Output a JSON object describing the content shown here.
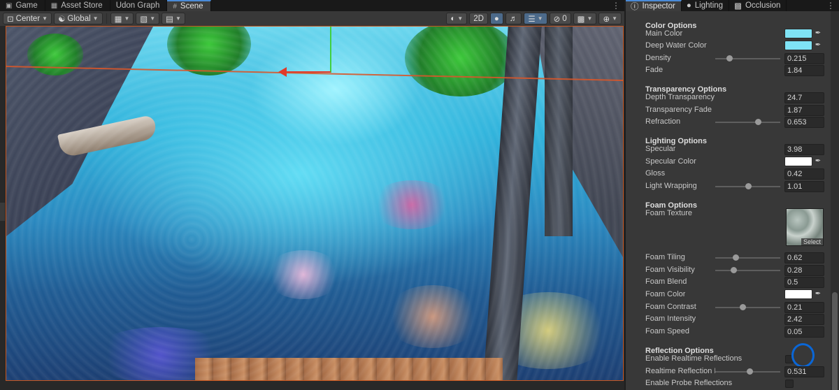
{
  "scene_tabs": [
    {
      "label": "Game",
      "icon": "gamepad-icon"
    },
    {
      "label": "Asset Store",
      "icon": "store-icon"
    },
    {
      "label": "Udon Graph",
      "icon": ""
    },
    {
      "label": "Scene",
      "icon": "grid-icon",
      "active": true
    }
  ],
  "toolbar": {
    "pivot_mode": "Center",
    "pivot_space": "Global",
    "mode_2d": "2D"
  },
  "inspector_tabs": [
    {
      "label": "Inspector",
      "icon": "info-icon",
      "active": true
    },
    {
      "label": "Lighting",
      "icon": "bulb-icon"
    },
    {
      "label": "Occlusion",
      "icon": "occlusion-icon"
    }
  ],
  "sections": {
    "color": "Color Options",
    "transparency": "Transparency Options",
    "lighting": "Lighting Options",
    "foam": "Foam Options",
    "reflection": "Reflection Options"
  },
  "props": {
    "main_color": {
      "label": "Main Color",
      "color": "#7fe3f5"
    },
    "deep_water_color": {
      "label": "Deep Water Color",
      "color": "#7fe3f5"
    },
    "density": {
      "label": "Density",
      "value": "0.215",
      "level": 0.215
    },
    "fade": {
      "label": "Fade",
      "value": "1.84"
    },
    "depth_transparency": {
      "label": "Depth Transparency",
      "value": "24.7"
    },
    "transparency_fade": {
      "label": "Transparency Fade",
      "value": "1.87"
    },
    "refraction": {
      "label": "Refraction",
      "value": "0.653",
      "level": 0.653
    },
    "specular": {
      "label": "Specular",
      "value": "3.98"
    },
    "specular_color": {
      "label": "Specular Color",
      "color": "#ffffff"
    },
    "gloss": {
      "label": "Gloss",
      "value": "0.42"
    },
    "light_wrapping": {
      "label": "Light Wrapping",
      "value": "1.01",
      "level": 0.5
    },
    "foam_texture": {
      "label": "Foam Texture",
      "select": "Select"
    },
    "foam_tiling": {
      "label": "Foam Tiling",
      "value": "0.62",
      "level": 0.31
    },
    "foam_visibility": {
      "label": "Foam Visibility",
      "value": "0.28",
      "level": 0.28
    },
    "foam_blend": {
      "label": "Foam Blend",
      "value": "0.5"
    },
    "foam_color": {
      "label": "Foam Color",
      "color": "#ffffff"
    },
    "foam_contrast": {
      "label": "Foam Contrast",
      "value": "0.21",
      "level": 0.42
    },
    "foam_intensity": {
      "label": "Foam Intensity",
      "value": "2.42"
    },
    "foam_speed": {
      "label": "Foam Speed",
      "value": "0.05"
    },
    "enable_realtime_reflections": {
      "label": "Enable Realtime Reflections"
    },
    "realtime_reflection_intensity": {
      "label": "Realtime Reflection Ir",
      "value": "0.531",
      "level": 0.531
    },
    "enable_probe_reflections": {
      "label": "Enable Probe Reflections"
    }
  }
}
